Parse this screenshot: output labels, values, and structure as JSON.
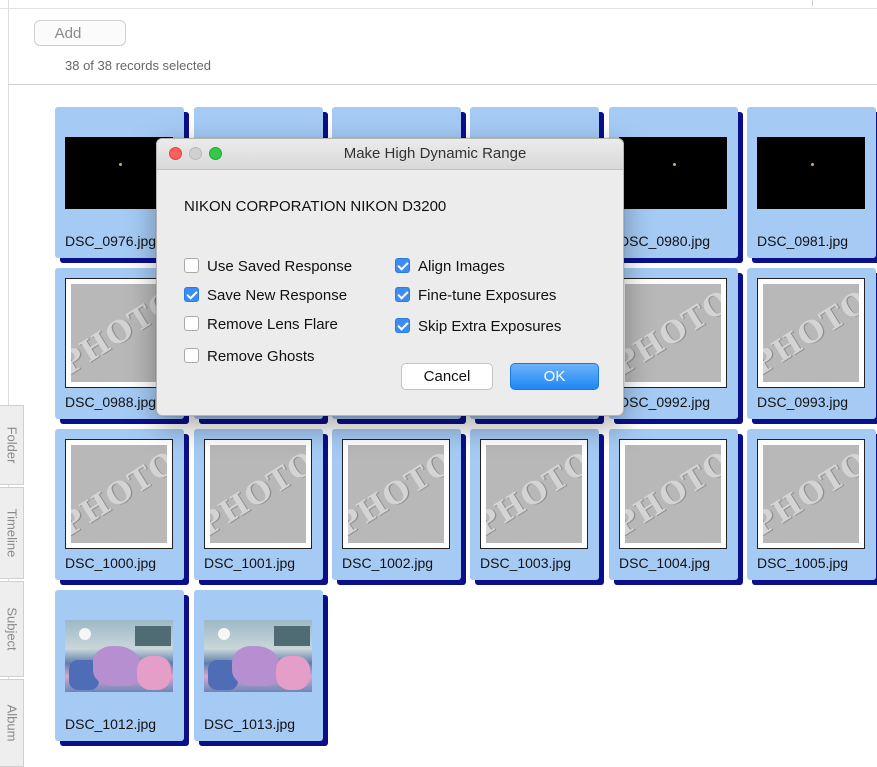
{
  "toolbar": {
    "add_label": "Add"
  },
  "status": {
    "records_selected": "38 of 38 records selected"
  },
  "side_tabs": [
    "Folder",
    "Timeline",
    "Subject",
    "Album"
  ],
  "tiles": [
    "DSC_0976.jpg",
    "DSC_0980.jpg",
    "DSC_0981.jpg",
    "DSC_0988.jpg",
    "DSC_0992.jpg",
    "DSC_0993.jpg",
    "DSC_1000.jpg",
    "DSC_1001.jpg",
    "DSC_1002.jpg",
    "DSC_1003.jpg",
    "DSC_1004.jpg",
    "DSC_1005.jpg",
    "DSC_1012.jpg",
    "DSC_1013.jpg"
  ],
  "placeholder_word": "PHOTO",
  "dialog": {
    "title": "Make High Dynamic Range",
    "camera": "NIKON CORPORATION NIKON D3200",
    "options_left": [
      {
        "label": "Use Saved Response",
        "checked": false
      },
      {
        "label": "Save New Response",
        "checked": true
      },
      {
        "label": "Remove Lens Flare",
        "checked": false
      },
      {
        "label": "Remove Ghosts",
        "checked": false
      }
    ],
    "options_right": [
      {
        "label": "Align Images",
        "checked": true
      },
      {
        "label": "Fine-tune Exposures",
        "checked": true
      },
      {
        "label": "Skip Extra Exposures",
        "checked": true
      }
    ],
    "cancel_label": "Cancel",
    "ok_label": "OK"
  },
  "colors": {
    "tile_selected": "#a5cbf5",
    "tile_shadow": "#0b0f8a",
    "checkbox_on": "#3b8cf3",
    "ok_button": "#1e86f4"
  }
}
